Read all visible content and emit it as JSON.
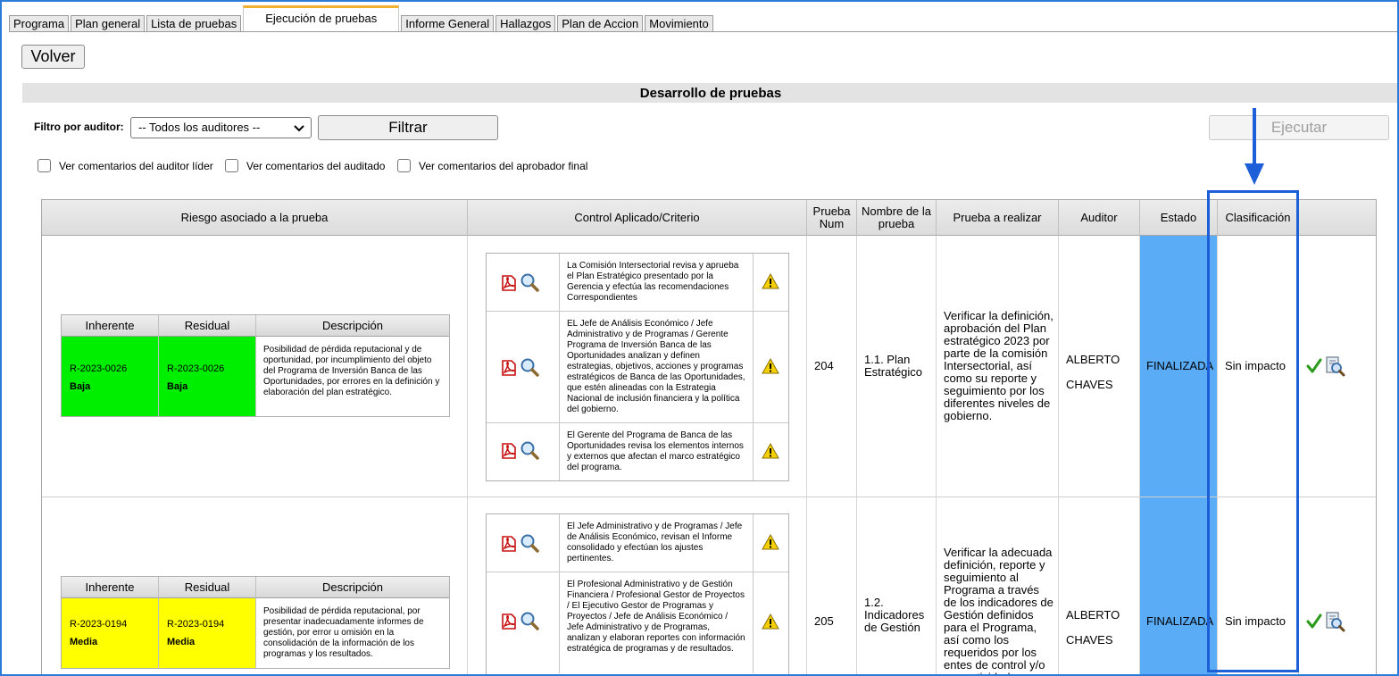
{
  "tabs": [
    "Programa",
    "Plan general",
    "Lista de pruebas",
    "Ejecución de pruebas",
    "Informe General",
    "Hallazgos",
    "Plan de Accion",
    "Movimiento"
  ],
  "active_tab": "Ejecución de pruebas",
  "volver_label": "Volver",
  "section_title": "Desarrollo de pruebas",
  "filter": {
    "label": "Filtro por auditor:",
    "selected": "-- Todos los auditores --",
    "filter_button": "Filtrar",
    "execute_button": "Ejecutar"
  },
  "checkboxes": [
    "Ver comentarios del auditor líder",
    "Ver comentarios del auditado",
    "Ver comentarios del aprobador final"
  ],
  "columns": [
    "Riesgo asociado a la prueba",
    "Control Aplicado/Criterio",
    "Prueba Num",
    "Nombre de la prueba",
    "Prueba a realizar",
    "Auditor",
    "Estado",
    "Clasificación"
  ],
  "risk_headers": [
    "Inherente",
    "Residual",
    "Descripción"
  ],
  "colors": {
    "baja": "#00ee00",
    "media": "#ffff00",
    "estado": "#5aacf7",
    "highlight": "#1d5fd8"
  },
  "rows": [
    {
      "risk": {
        "inherente_code": "R-2023-0026",
        "inherente_level": "Baja",
        "residual_code": "R-2023-0026",
        "residual_level": "Baja",
        "descripcion": "Posibilidad de pérdida reputacional y de oportunidad, por incumplimiento del objeto del Programa de Inversión Banca de las Oportunidades, por errores en la definición y elaboración del plan estratégico."
      },
      "controls": [
        "La Comisión Intersectorial revisa y aprueba el Plan Estratégico presentado por la Gerencia y efectúa las recomendaciones Correspondientes",
        "EL Jefe de Análisis Económico / Jefe Administrativo y de Programas / Gerente Programa de Inversión Banca de las Oportunidades analizan y definen estrategias, objetivos, acciones y programas estratégicos de Banca de las Oportunidades, que estén alineadas con la Estrategia Nacional de inclusión financiera y la política del gobierno.",
        "El Gerente del Programa de Banca de las Oportunidades revisa los elementos internos y externos que afectan el marco estratégico del programa."
      ],
      "prueba_num": "204",
      "nombre": "1.1. Plan Estratégico",
      "prueba_realizar": "Verificar la definición, aprobación del Plan estratégico 2023 por parte de la comisión Intersectorial, así como su reporte y seguimiento por los diferentes niveles de gobierno.",
      "auditor_first": "ALBERTO",
      "auditor_last": "CHAVES",
      "estado": "FINALIZADA",
      "clasificacion": "Sin impacto"
    },
    {
      "risk": {
        "inherente_code": "R-2023-0194",
        "inherente_level": "Media",
        "residual_code": "R-2023-0194",
        "residual_level": "Media",
        "descripcion": "Posibilidad de pérdida reputacional, por presentar inadecuadamente informes de gestión, por error u omisión en la consolidación de la información de los programas y los resultados."
      },
      "controls": [
        "El Jefe Administrativo y de Programas / Jefe de Análisis Económico, revisan el Informe consolidado y efectúan los ajustes pertinentes.",
        "El Profesional Administrativo y de Gestión Financiera / Profesional Gestor de Proyectos / El Ejecutivo Gestor de Programas y Proyectos / Jefe de Análisis Económico / Jefe Administrativo y de Programas, analizan y elaboran reportes con información estratégica de programas y de resultados."
      ],
      "prueba_num": "205",
      "nombre": "1.2. Indicadores de Gestión",
      "prueba_realizar": "Verificar la adecuada definición, reporte y seguimiento al Programa a través de los indicadores de Gestión definidos para el Programa, así como los requeridos por los entes de control y/o normatividad",
      "auditor_first": "ALBERTO",
      "auditor_last": "CHAVES",
      "estado": "FINALIZADA",
      "clasificacion": "Sin impacto"
    }
  ]
}
